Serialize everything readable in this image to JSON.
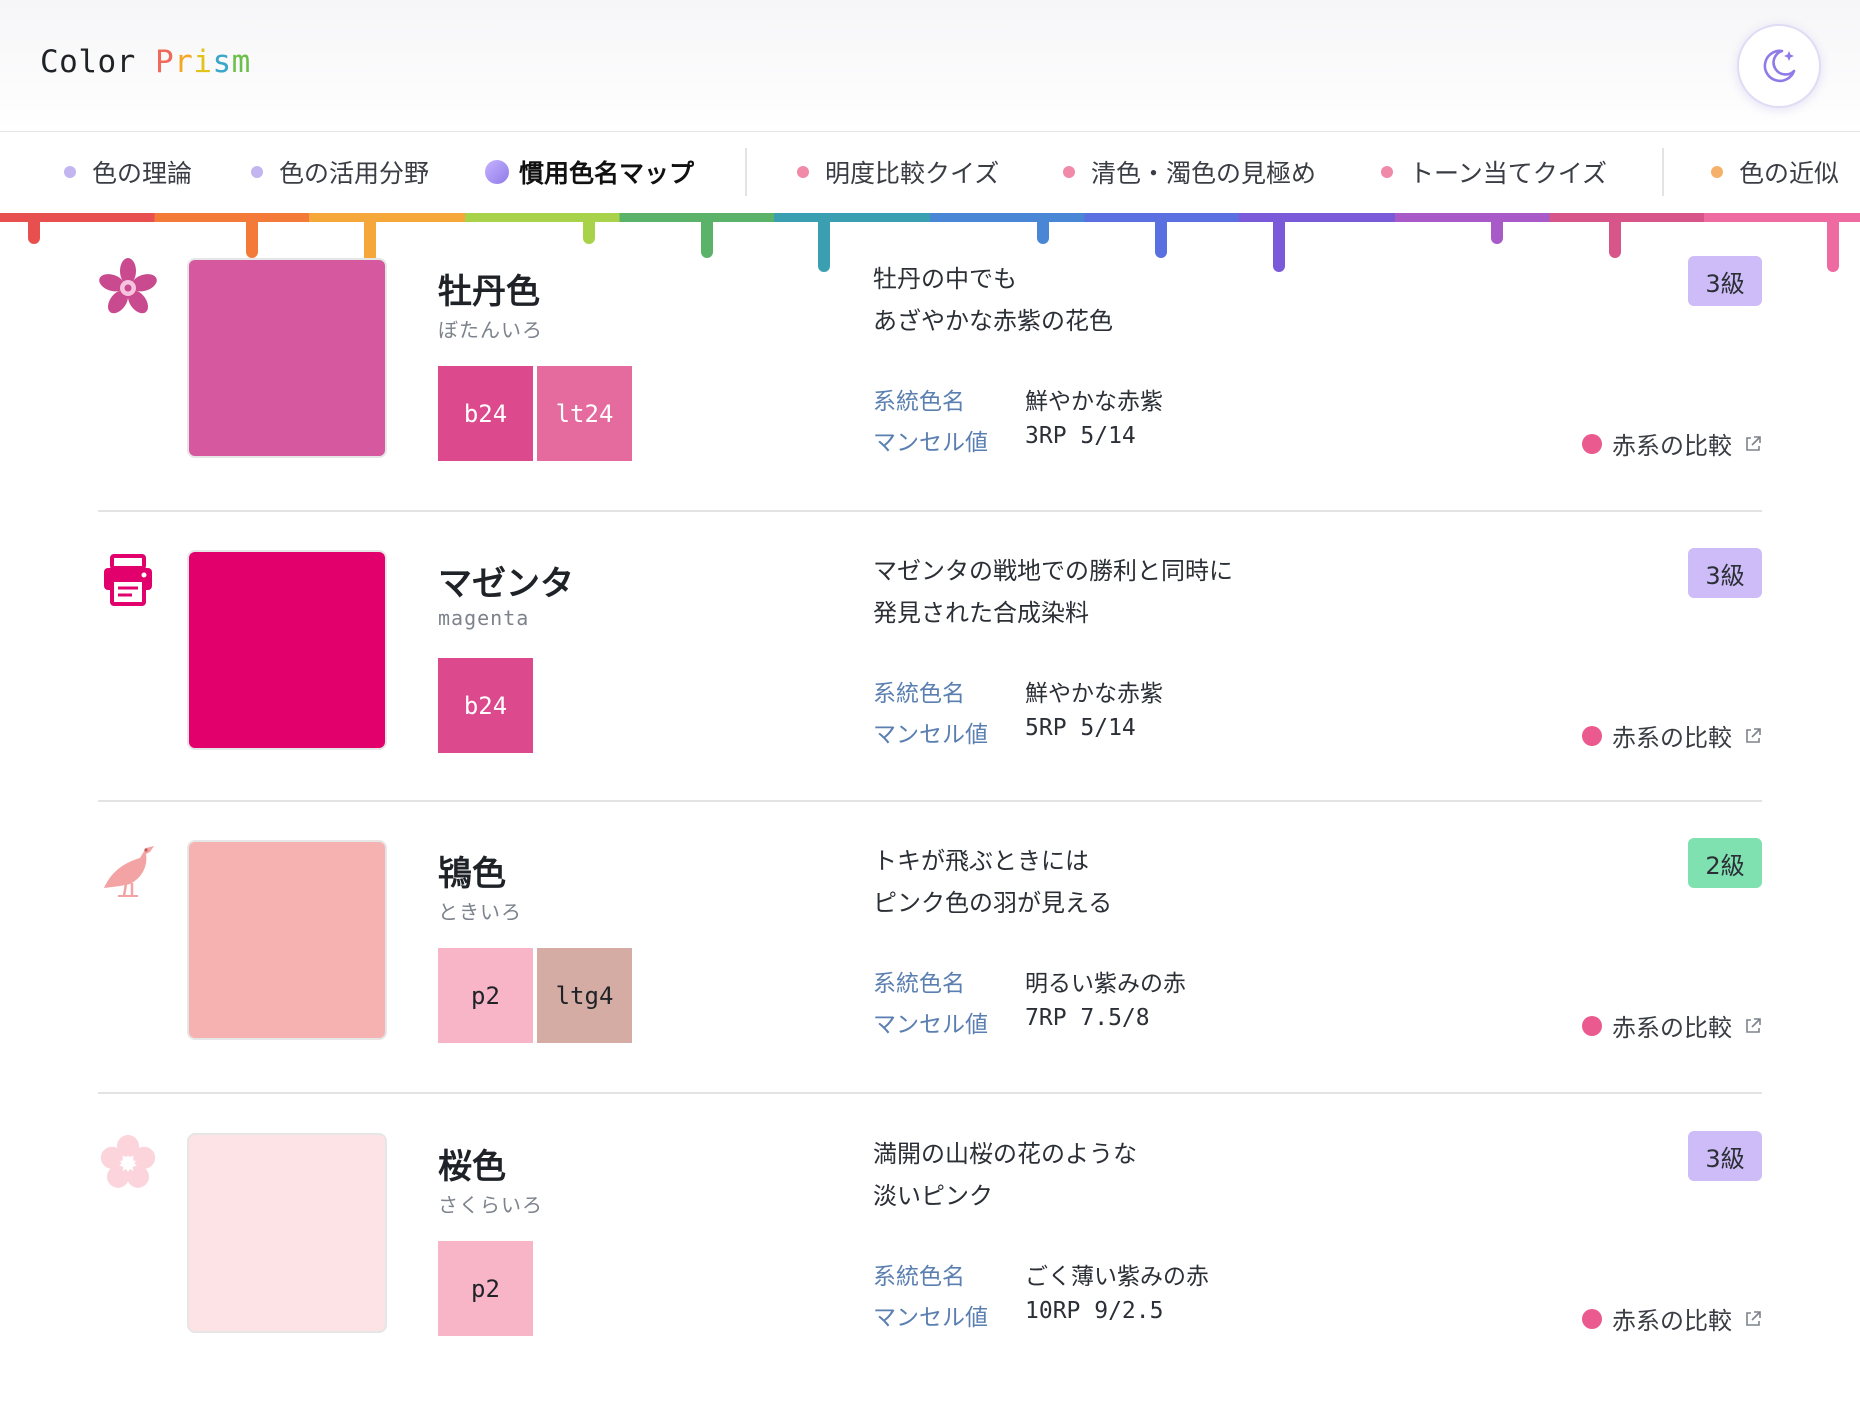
{
  "header": {
    "logo_part1": "Color ",
    "logo_letters": [
      "P",
      "r",
      "i",
      "s",
      "m"
    ],
    "theme_icon": "moon-sparkle-icon"
  },
  "nav": {
    "items": [
      {
        "label": "色の理論",
        "dot_color": "#c2b5f0"
      },
      {
        "label": "色の活用分野",
        "dot_color": "#c2b5f0"
      },
      {
        "label": "慣用色名マップ",
        "dot_color": "#9b87ee",
        "active": true
      },
      {
        "label": "明度比較クイズ",
        "dot_color": "#f08aa8"
      },
      {
        "label": "清色・濁色の見極め",
        "dot_color": "#f08aa8"
      },
      {
        "label": "トーン当てクイズ",
        "dot_color": "#f08aa8"
      },
      {
        "label": "色の近似",
        "dot_color": "#f5b06a"
      }
    ]
  },
  "rainbow_colors": [
    "#e8504f",
    "#f47a3a",
    "#f6a73a",
    "#a8d24a",
    "#5bb36a",
    "#3a9fb0",
    "#4a86d6",
    "#5a6fe0",
    "#7a5ad8",
    "#a85ac8",
    "#d8558a",
    "#ee6aa0"
  ],
  "colors": [
    {
      "icon": "peony-flower-icon",
      "swatch": "#d6589f",
      "name": "牡丹色",
      "reading": "ぼたんいろ",
      "chips": [
        {
          "label": "b24",
          "bg": "#dc4a8d",
          "fg": "#ffffff"
        },
        {
          "label": "lt24",
          "bg": "#e56a9d",
          "fg": "#ffffff"
        }
      ],
      "desc": [
        "牡丹の中でも",
        "あざやかな赤紫の花色"
      ],
      "systematic_label": "系統色名",
      "systematic": "鮮やかな赤紫",
      "munsell_label": "マンセル値",
      "munsell": "3RP 5/14",
      "grade": "3級",
      "grade_bg": "#cdbcf7",
      "compare": "赤系の比較"
    },
    {
      "icon": "printer-icon",
      "swatch": "#e2006d",
      "name": "マゼンタ",
      "reading": "magenta",
      "chips": [
        {
          "label": "b24",
          "bg": "#dc4a8d",
          "fg": "#ffffff"
        }
      ],
      "desc": [
        "マゼンタの戦地での勝利と同時に",
        "発見された合成染料"
      ],
      "systematic_label": "系統色名",
      "systematic": "鮮やかな赤紫",
      "munsell_label": "マンセル値",
      "munsell": "5RP 5/14",
      "grade": "3級",
      "grade_bg": "#cdbcf7",
      "compare": "赤系の比較"
    },
    {
      "icon": "ibis-bird-icon",
      "swatch": "#f6b1b1",
      "name": "鴇色",
      "reading": "ときいろ",
      "chips": [
        {
          "label": "p2",
          "bg": "#f8b5c8",
          "fg": "#1f2328"
        },
        {
          "label": "ltg4",
          "bg": "#d4aca4",
          "fg": "#1f2328"
        }
      ],
      "desc": [
        "トキが飛ぶときには",
        "ピンク色の羽が見える"
      ],
      "systematic_label": "系統色名",
      "systematic": "明るい紫みの赤",
      "munsell_label": "マンセル値",
      "munsell": "7RP 7.5/8",
      "grade": "2級",
      "grade_bg": "#7fe0b0",
      "compare": "赤系の比較"
    },
    {
      "icon": "cherry-blossom-icon",
      "swatch": "#fde2e6",
      "name": "桜色",
      "reading": "さくらいろ",
      "chips": [
        {
          "label": "p2",
          "bg": "#f8b5c8",
          "fg": "#1f2328"
        }
      ],
      "desc": [
        "満開の山桜の花のような",
        "淡いピンク"
      ],
      "systematic_label": "系統色名",
      "systematic": "ごく薄い紫みの赤",
      "munsell_label": "マンセル値",
      "munsell": "10RP 9/2.5",
      "grade": "3級",
      "grade_bg": "#cdbcf7",
      "compare": "赤系の比較"
    }
  ]
}
